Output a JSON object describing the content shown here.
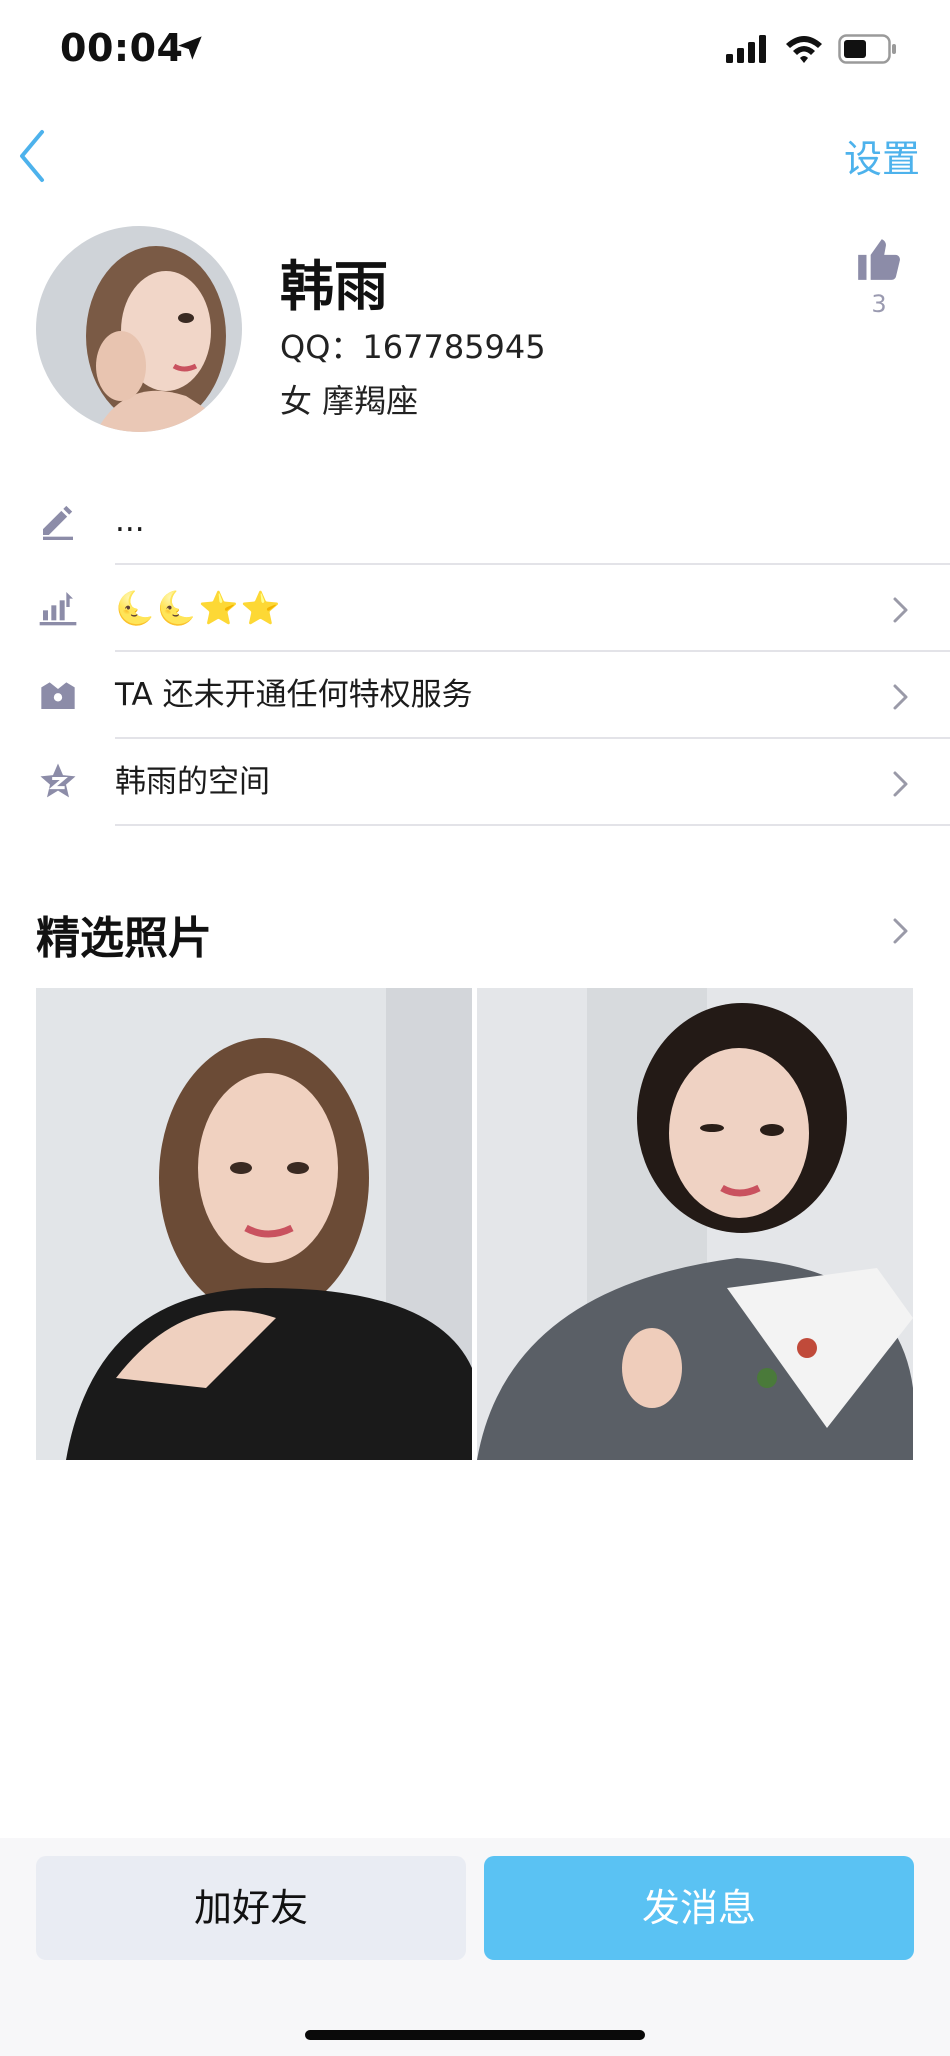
{
  "status_bar": {
    "time": "00:04"
  },
  "nav": {
    "settings_label": "设置"
  },
  "profile": {
    "name": "韩雨",
    "qq": "QQ：167785945",
    "gender_zodiac": "女  摩羯座",
    "like_count": "3"
  },
  "info_rows": [
    {
      "icon": "pencil-icon",
      "text": "..."
    },
    {
      "icon": "level-chart-icon",
      "badges": [
        "🌜",
        "🌜",
        "⭐",
        "⭐"
      ]
    },
    {
      "icon": "crown-box-icon",
      "text": "TA 还未开通任何特权服务"
    },
    {
      "icon": "zone-star-icon",
      "text": "韩雨的空间"
    }
  ],
  "photos": {
    "title": "精选照片"
  },
  "actions": {
    "add_friend": "加好友",
    "send_message": "发消息"
  },
  "colors": {
    "accent": "#4DB2EC",
    "primary_button": "#5ac2f3",
    "secondary_button": "#e9ecf3",
    "icon_gray": "#8c8ca8"
  }
}
